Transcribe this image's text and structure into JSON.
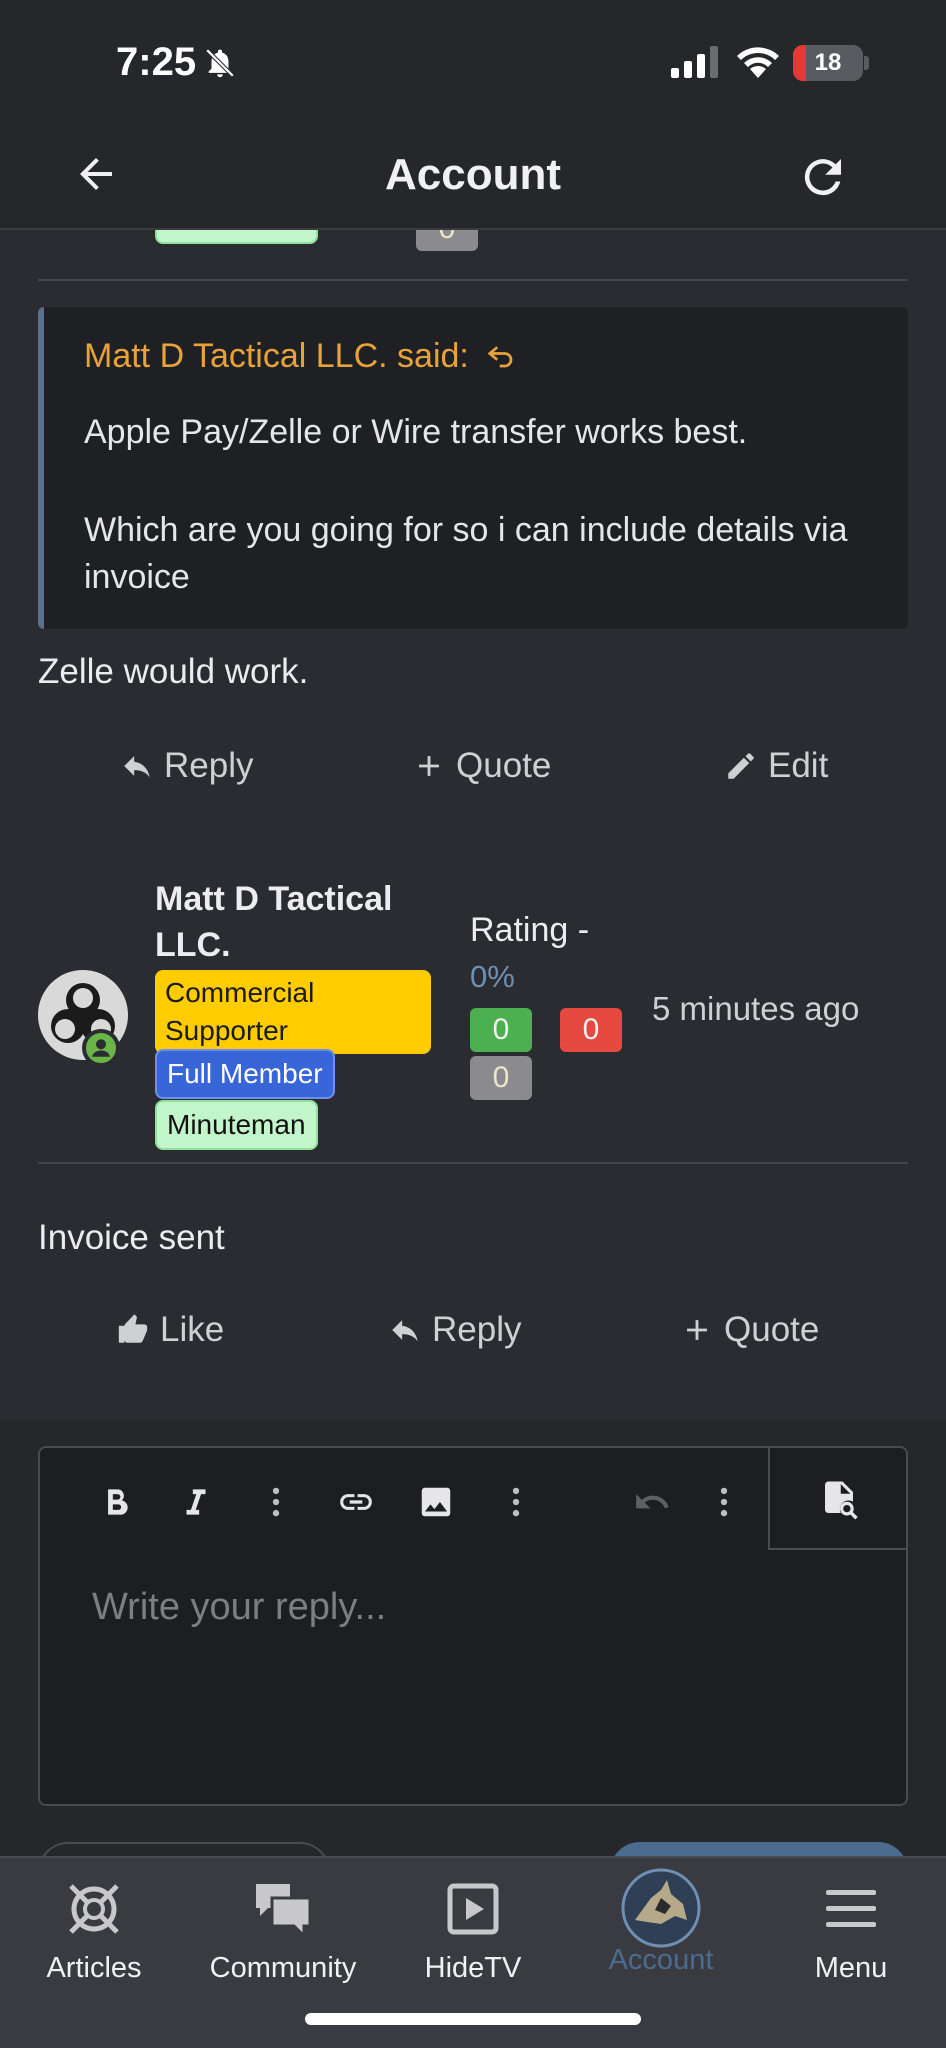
{
  "status_bar": {
    "time": "7:25",
    "battery": "18",
    "battery_level": 0.18
  },
  "nav": {
    "title": "Account"
  },
  "prev_post": {
    "tag_partial": "Minuteman",
    "count_partial": "0",
    "quote": {
      "author": "Matt D Tactical LLC. said:",
      "line1": "Apple Pay/Zelle or Wire transfer works best.",
      "line2": "Which are you going for so i can include details via invoice"
    },
    "body": "Zelle would work.",
    "actions": {
      "reply": "Reply",
      "quote": "Quote",
      "edit": "Edit"
    }
  },
  "post": {
    "author": "Matt D Tactical LLC.",
    "tags": [
      "Commercial Supporter",
      "Full Member",
      "Minuteman"
    ],
    "rating_label": "Rating -",
    "rating_value": "0%",
    "counts": {
      "positive": "0",
      "negative": "0",
      "neutral": "0"
    },
    "time": "5 minutes ago",
    "body": "Invoice sent",
    "actions": {
      "like": "Like",
      "reply": "Reply",
      "quote": "Quote"
    }
  },
  "editor": {
    "placeholder": "Write your reply..."
  },
  "tabs": [
    {
      "label": "Articles"
    },
    {
      "label": "Community"
    },
    {
      "label": "HideTV"
    },
    {
      "label": "Account"
    },
    {
      "label": "Menu"
    }
  ],
  "colors": {
    "accent_quote": "#e7a23a",
    "active_tab": "#4b6b8f",
    "rating": "#6f8fb4"
  }
}
